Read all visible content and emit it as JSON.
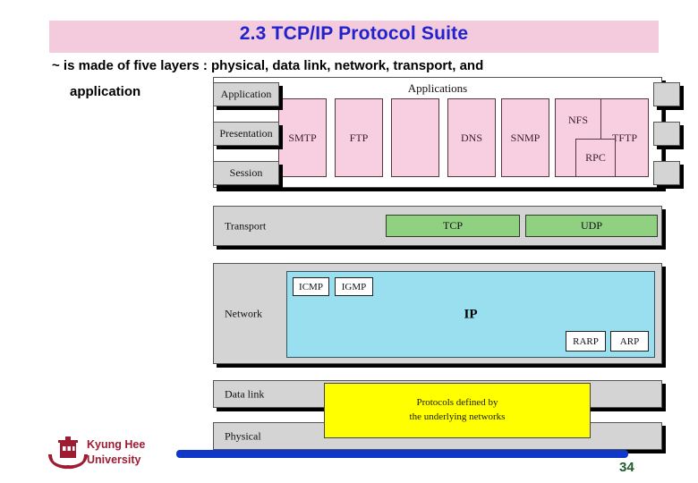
{
  "slide": {
    "title": "2.3 TCP/IP Protocol Suite",
    "title_bg": "#f3cbdd",
    "title_color": "#2222cc",
    "bullet_line_1": "~ is made of five layers : physical, data link, network, transport, and",
    "bullet_line_2": "application",
    "page_number": "34"
  },
  "footer": {
    "university_line_1": "Kyung Hee",
    "university_line_2": "University",
    "logo_icon": "crest-emblem-icon",
    "brand_color": "#9e1b32",
    "bar_color": "#1037c8"
  },
  "diagram": {
    "osi_tabs": [
      {
        "label": "Application"
      },
      {
        "label": "Presentation"
      },
      {
        "label": "Session"
      }
    ],
    "application_container": {
      "title": "Applications",
      "protocols": [
        {
          "label": "SMTP"
        },
        {
          "label": "FTP"
        },
        {
          "label": ""
        },
        {
          "label": "DNS"
        },
        {
          "label": "SNMP"
        },
        {
          "label": "NFS"
        },
        {
          "label": "RPC"
        },
        {
          "label": "TFTP"
        }
      ],
      "protocol_color": "#f8cfe0"
    },
    "transport": {
      "label": "Transport",
      "protocols": [
        {
          "label": "TCP"
        },
        {
          "label": "UDP"
        }
      ],
      "protocol_color": "#8fd081"
    },
    "network": {
      "label": "Network",
      "main_protocol": "IP",
      "protocol_color": "#9adff0",
      "top_protocols": [
        {
          "label": "ICMP"
        },
        {
          "label": "IGMP"
        }
      ],
      "bottom_protocols": [
        {
          "label": "RARP"
        },
        {
          "label": "ARP"
        }
      ]
    },
    "data_link": {
      "label": "Data link"
    },
    "physical": {
      "label": "Physical"
    },
    "note": {
      "line_1": "Protocols defined by",
      "line_2": "the underlying networks",
      "color": "#ffff00"
    }
  }
}
